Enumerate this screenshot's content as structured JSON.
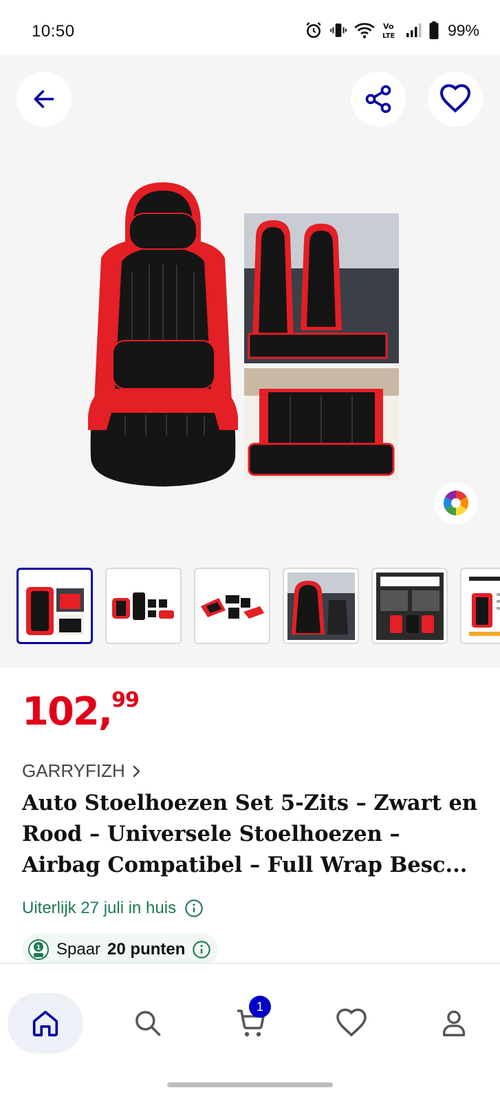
{
  "status_bar": {
    "time": "10:50",
    "battery": "99%"
  },
  "gallery": {
    "thumbnails": [
      {
        "name": "thumb-seat-set"
      },
      {
        "name": "thumb-parts-flatlay"
      },
      {
        "name": "thumb-parts-flatlay-2"
      },
      {
        "name": "thumb-car-interior"
      },
      {
        "name": "thumb-info-sheet"
      },
      {
        "name": "thumb-info-sheet-2"
      }
    ]
  },
  "product": {
    "price_euros": "102,",
    "price_cents": "99",
    "brand": "GARRYFIZH",
    "title": "Auto Stoelhoezen Set 5-Zits – Zwart en Rood – Universele Stoelhoezen – Airbag Compatibel – Full Wrap Besc...",
    "delivery": "Uiterlijk 27 juli in huis",
    "points_prefix": "Spaar",
    "points_value": "20 punten"
  },
  "nav": {
    "cart_count": "1"
  },
  "colors": {
    "accent": "#0000a4",
    "price": "#e0001b",
    "delivery": "#1d7a52",
    "seat_red": "#e41f25",
    "seat_black": "#151515"
  }
}
